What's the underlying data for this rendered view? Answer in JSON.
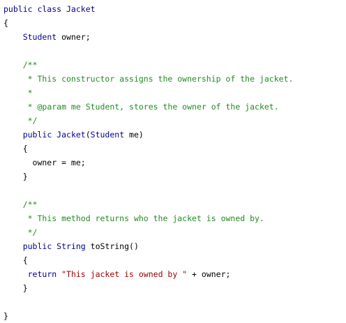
{
  "lines": [
    {
      "tokens": [
        {
          "t": "kw",
          "s": "public class Jacket"
        }
      ]
    },
    {
      "tokens": [
        {
          "t": "txt",
          "s": "{"
        }
      ]
    },
    {
      "tokens": [
        {
          "t": "txt",
          "s": "    "
        },
        {
          "t": "kw",
          "s": "Student"
        },
        {
          "t": "txt",
          "s": " owner;"
        }
      ]
    },
    {
      "tokens": []
    },
    {
      "tokens": [
        {
          "t": "txt",
          "s": "    "
        },
        {
          "t": "cm",
          "s": "/**"
        }
      ]
    },
    {
      "tokens": [
        {
          "t": "txt",
          "s": "     "
        },
        {
          "t": "cm",
          "s": "* This constructor assigns the ownership of the jacket."
        }
      ]
    },
    {
      "tokens": [
        {
          "t": "txt",
          "s": "     "
        },
        {
          "t": "cm",
          "s": "*"
        }
      ]
    },
    {
      "tokens": [
        {
          "t": "txt",
          "s": "     "
        },
        {
          "t": "cm",
          "s": "* @param me Student, stores the owner of the jacket."
        }
      ]
    },
    {
      "tokens": [
        {
          "t": "txt",
          "s": "     "
        },
        {
          "t": "cm",
          "s": "*/"
        }
      ]
    },
    {
      "tokens": [
        {
          "t": "txt",
          "s": "    "
        },
        {
          "t": "kw",
          "s": "public Jacket"
        },
        {
          "t": "txt",
          "s": "("
        },
        {
          "t": "kw",
          "s": "Student"
        },
        {
          "t": "txt",
          "s": " me)"
        }
      ]
    },
    {
      "tokens": [
        {
          "t": "txt",
          "s": "    {"
        }
      ]
    },
    {
      "tokens": [
        {
          "t": "txt",
          "s": "      owner = me;"
        }
      ]
    },
    {
      "tokens": [
        {
          "t": "txt",
          "s": "    }"
        }
      ]
    },
    {
      "tokens": []
    },
    {
      "tokens": [
        {
          "t": "txt",
          "s": "    "
        },
        {
          "t": "cm",
          "s": "/**"
        }
      ]
    },
    {
      "tokens": [
        {
          "t": "txt",
          "s": "     "
        },
        {
          "t": "cm",
          "s": "* This method returns who the jacket is owned by."
        }
      ]
    },
    {
      "tokens": [
        {
          "t": "txt",
          "s": "     "
        },
        {
          "t": "cm",
          "s": "*/"
        }
      ]
    },
    {
      "tokens": [
        {
          "t": "txt",
          "s": "    "
        },
        {
          "t": "kw",
          "s": "public String"
        },
        {
          "t": "txt",
          "s": " toString()"
        }
      ]
    },
    {
      "tokens": [
        {
          "t": "txt",
          "s": "    {"
        }
      ]
    },
    {
      "tokens": [
        {
          "t": "txt",
          "s": "     "
        },
        {
          "t": "kw",
          "s": "return"
        },
        {
          "t": "txt",
          "s": " "
        },
        {
          "t": "str",
          "s": "\"This jacket is owned by \""
        },
        {
          "t": "txt",
          "s": " + owner;"
        }
      ]
    },
    {
      "tokens": [
        {
          "t": "txt",
          "s": "    }"
        }
      ]
    },
    {
      "tokens": []
    },
    {
      "tokens": [
        {
          "t": "txt",
          "s": "}"
        }
      ]
    }
  ],
  "colors": {
    "keyword": "#00008b",
    "comment": "#228b22",
    "string": "#a00000",
    "text": "#000000",
    "background": "#ffffff"
  }
}
